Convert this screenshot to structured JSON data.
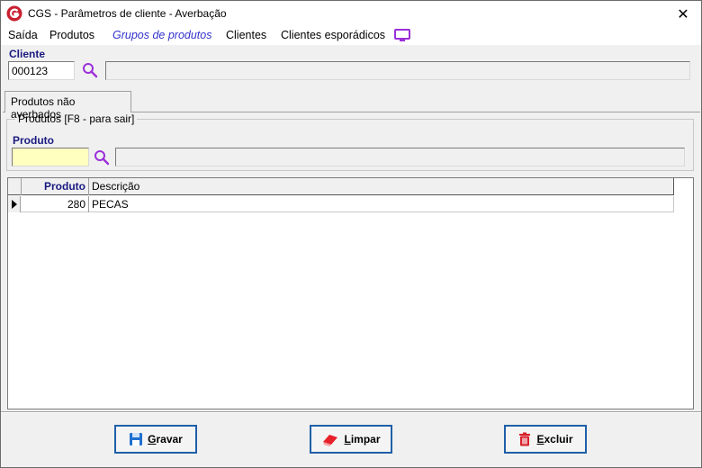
{
  "window": {
    "title": "CGS - Parâmetros de cliente - Averbação",
    "close_glyph": "✕"
  },
  "menu": {
    "items": [
      "Saída",
      "Produtos",
      "Grupos de produtos",
      "Clientes",
      "Clientes esporádicos"
    ],
    "active": "Grupos de produtos",
    "trailing_icon": "monitor-icon"
  },
  "cliente": {
    "label": "Cliente",
    "code": "000123",
    "name": ""
  },
  "tabs": [
    {
      "label": "Produtos não averbados",
      "selected": true
    }
  ],
  "group": {
    "title": "Produtos [F8 - para sair]",
    "produto_label": "Produto",
    "produto_value": "",
    "descricao_value": ""
  },
  "grid": {
    "columns": [
      "Produto",
      "Descrição"
    ],
    "rows": [
      {
        "produto": "280",
        "descricao": "PECAS"
      }
    ]
  },
  "buttons": {
    "gravar": {
      "first": "G",
      "rest": "ravar"
    },
    "limpar": {
      "first": "L",
      "rest": "impar"
    },
    "excluir": {
      "first": "E",
      "rest": "xcluir"
    }
  },
  "colors": {
    "accent_purple": "#9b30d9",
    "label_navy": "#1a1a80",
    "button_border": "#1f5fa8",
    "yellow_field": "#ffffc0"
  }
}
